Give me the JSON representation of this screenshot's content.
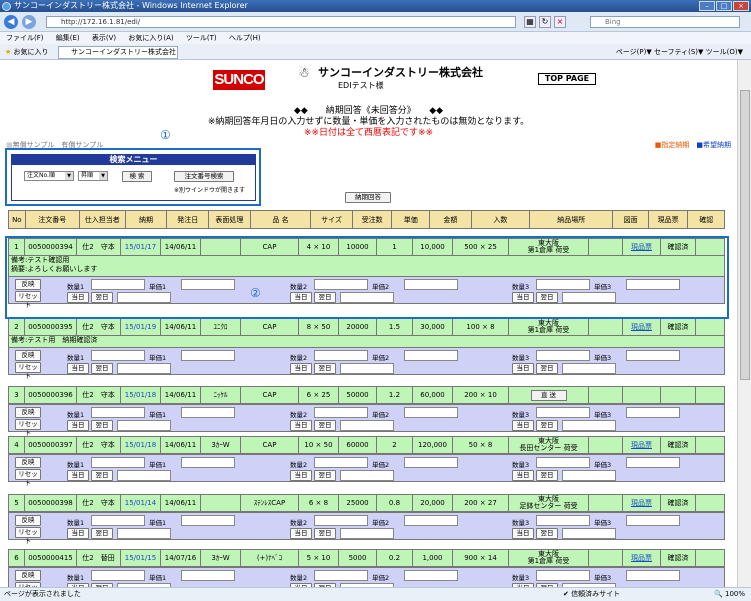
{
  "browser": {
    "window_title": "サンコーインダストリー株式会社 - Windows Internet Explorer",
    "url": "http://172.16.1.81/edi/",
    "search_placeholder": "Bing",
    "menu": [
      "ファイル(F)",
      "編集(E)",
      "表示(V)",
      "お気に入り(A)",
      "ツール(T)",
      "ヘルプ(H)"
    ],
    "favorites_label": "お気に入り",
    "tab_title": "サンコーインダストリー株式会社",
    "toolbar_right": "ページ(P)▼  セーフティ(S)▼  ツール(O)▼",
    "status_left": "ページが表示されました",
    "status_mid": "信頼済みサイト",
    "zoom": "100%"
  },
  "header": {
    "logo": "SUNCO",
    "company": "サンコーインダストリー株式会社",
    "sub": "EDIテスト様",
    "top_page": "TOP PAGE",
    "title": "◆◆　　納期回答《未回答分》　　◆◆",
    "notice1": "※納期回答年月日の入力せずに数量・単価を入力されたものは無効となります。",
    "notice2": "※※日付は全て西暦表記です※※"
  },
  "legend": {
    "left": "無償サンプル　有償サンプル",
    "right_orange": "■指定納期",
    "right_blue": "■希望納期"
  },
  "annotations": {
    "one": "①",
    "two": "②"
  },
  "search_menu": {
    "title": "検索メニュー",
    "sort_field": "注文No.順",
    "sort_order": "昇順",
    "search_button": "検 索",
    "order_search_button": "注文番号検索",
    "note": "※別ウインドウが開きます",
    "answer_button": "納期回答"
  },
  "columns": [
    "No",
    "注文番号",
    "仕入担当者",
    "納期",
    "発注日",
    "表面処理",
    "品 名",
    "サイズ",
    "受注数",
    "単価",
    "金額",
    "入数",
    "納品場所",
    "図面",
    "現品票",
    "確認"
  ],
  "form_labels": {
    "apply": "反映",
    "reset": "リセット",
    "qty1": "数量1",
    "qty2": "数量2",
    "qty3": "数量3",
    "price1": "単価1",
    "price2": "単価2",
    "price3": "単価3",
    "today": "当日",
    "next_day": "翌日"
  },
  "rows": [
    {
      "no": "1",
      "order": "0050000394",
      "staff": "仕2　守本",
      "due": "15/01/17",
      "ordered": "14/06/11",
      "finish": "",
      "item": "CAP",
      "size": "4 × 10",
      "qty": "10000",
      "price": "1",
      "amount": "10,000",
      "pack": "500 × 25",
      "place1": "東大阪",
      "place2": "第1倉庫 荷受",
      "drawing": "",
      "slip": "現品票",
      "confirm": "確認済",
      "note1": "備考:テスト確認用",
      "note2": "摘要:よろしくお願いします"
    },
    {
      "no": "2",
      "order": "0050000395",
      "staff": "仕2　守本",
      "due": "15/01/19",
      "ordered": "14/06/11",
      "finish": "ﾕﾆｸﾛ",
      "item": "CAP",
      "size": "8 × 50",
      "qty": "20000",
      "price": "1.5",
      "amount": "30,000",
      "pack": "100 × 8",
      "place1": "東大阪",
      "place2": "第1倉庫 荷受",
      "drawing": "",
      "slip": "現品票",
      "confirm": "確認済",
      "note1": "備考:テスト用　納期確認済",
      "note2": ""
    },
    {
      "no": "3",
      "order": "0050000396",
      "staff": "仕2　守本",
      "due": "15/01/18",
      "ordered": "14/06/11",
      "finish": "ﾆｯｹﾙ",
      "item": "CAP",
      "size": "6 × 25",
      "qty": "50000",
      "price": "1.2",
      "amount": "60,000",
      "pack": "200 × 10",
      "place1": "",
      "place2": "",
      "drawing": "",
      "slip": "",
      "confirm": "",
      "send": "直 送",
      "note1": "",
      "note2": ""
    },
    {
      "no": "4",
      "order": "0050000397",
      "staff": "仕2　守本",
      "due": "15/01/18",
      "ordered": "14/06/11",
      "finish": "3ｶｰW",
      "item": "CAP",
      "size": "10 × 50",
      "qty": "60000",
      "price": "2",
      "amount": "120,000",
      "pack": "50 × 8",
      "place1": "東大阪",
      "place2": "長田センター 荷受",
      "drawing": "",
      "slip": "現品票",
      "confirm": "確認済",
      "note1": "",
      "note2": ""
    },
    {
      "no": "5",
      "order": "0050000398",
      "staff": "仕2　守本",
      "due": "15/01/14",
      "ordered": "14/06/11",
      "finish": "",
      "item": "ｽﾃﾝﾚｽCAP",
      "size": "6 × 8",
      "qty": "25000",
      "price": "0.8",
      "amount": "20,000",
      "pack": "200 × 27",
      "place1": "東大阪",
      "place2": "足鉢センター 荷受",
      "drawing": "",
      "slip": "現品票",
      "confirm": "確認済",
      "note1": "",
      "note2": ""
    },
    {
      "no": "6",
      "order": "0050000415",
      "staff": "仕2　替田",
      "due": "15/01/15",
      "ordered": "14/07/16",
      "finish": "3ｶｰW",
      "item": "(+)ﾅﾍﾞｺ",
      "size": "5 × 10",
      "qty": "5000",
      "price": "0.2",
      "amount": "1,000",
      "pack": "900 × 14",
      "place1": "東大阪",
      "place2": "第1倉庫 荷受",
      "drawing": "",
      "slip": "現品票",
      "confirm": "確認済",
      "note1": "",
      "note2": ""
    }
  ]
}
